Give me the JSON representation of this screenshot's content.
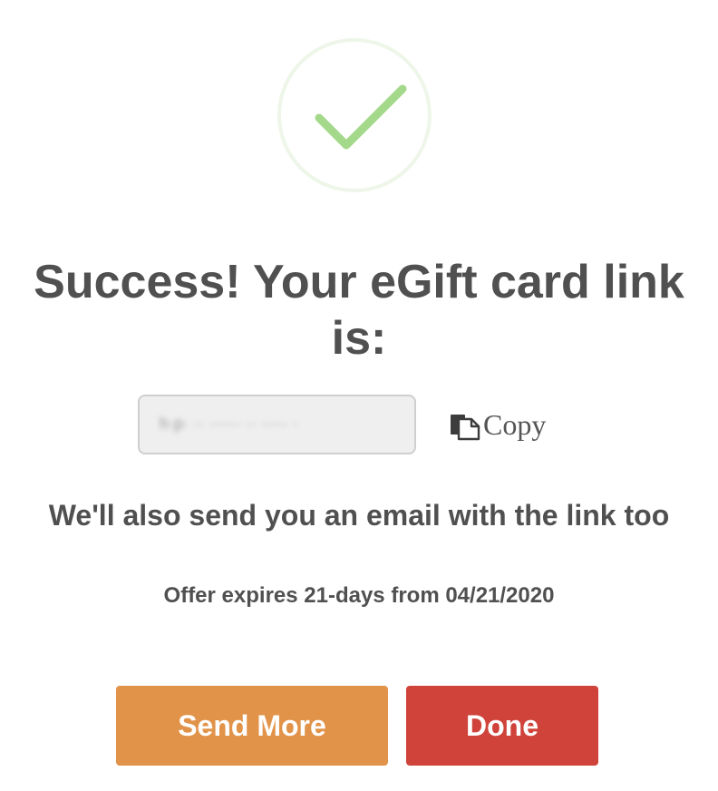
{
  "success": {
    "icon": "checkmark-icon",
    "circle_color": "#eef6e9",
    "check_color": "#a4d98b"
  },
  "title": "Success! Your eGift card link is:",
  "link_field": {
    "value_obscured": "h·p· ·· ······ ·· ····· ·"
  },
  "copy": {
    "icon": "copy-icon",
    "label": "Copy"
  },
  "email_note": "We'll also send you an email with the link too",
  "expires_text": "Offer expires 21-days from 04/21/2020",
  "buttons": {
    "send_more_label": "Send More",
    "send_more_color": "#e2934a",
    "done_label": "Done",
    "done_color": "#cf433a"
  }
}
